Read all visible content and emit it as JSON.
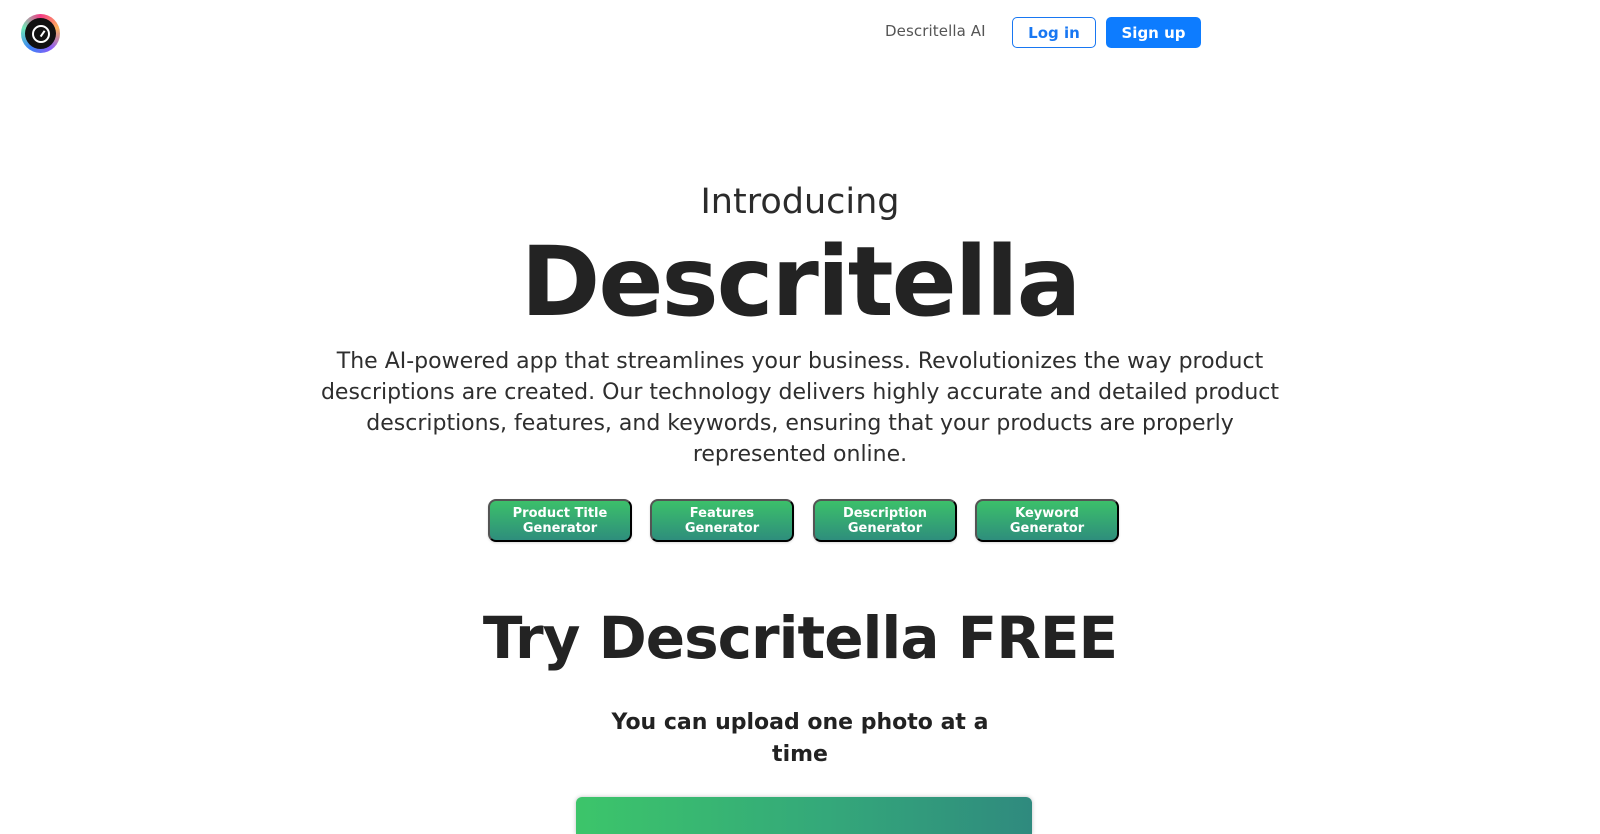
{
  "header": {
    "logo_icon": "descritella-logo-icon",
    "nav_link": "Descritella AI",
    "login_label": "Log in",
    "signup_label": "Sign up"
  },
  "hero": {
    "intro": "Introducing",
    "title": "Descritella",
    "description": "The AI-powered app that streamlines your  business. Revolutionizes the way product descriptions are created. Our technology delivers highly accurate and detailed product descriptions, features, and keywords, ensuring that your products are properly represented online."
  },
  "generators": [
    {
      "label": "Product Title Generator"
    },
    {
      "label": "Features Generator"
    },
    {
      "label": "Description Generator"
    },
    {
      "label": "Keyword Generator"
    }
  ],
  "try": {
    "title": "Try Descritella FREE",
    "note": "You can upload one photo at a time"
  },
  "colors": {
    "primary": "#0d7cff",
    "green_start": "#3cc06a",
    "green_end": "#2e8e7c"
  }
}
